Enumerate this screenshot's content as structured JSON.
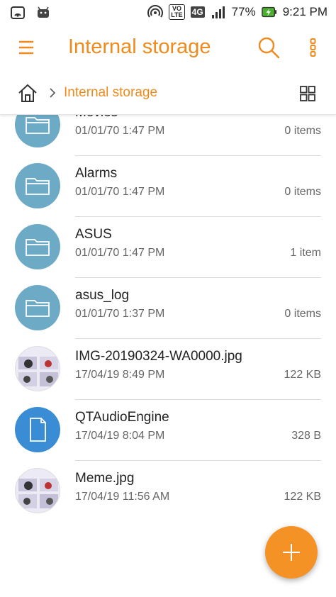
{
  "status_bar": {
    "battery_percent": "77%",
    "time": "9:21 PM",
    "volte_label": "VO\nLTE",
    "network_label": "4G",
    "icons": [
      "hotspot-icon",
      "android-icon",
      "wifi-calling-icon",
      "volte-icon",
      "network-4g-icon",
      "signal-icon",
      "battery-charging-icon"
    ]
  },
  "app_bar": {
    "title": "Internal storage",
    "icons": [
      "menu-icon",
      "search-icon",
      "more-vertical-icon"
    ]
  },
  "breadcrumb": {
    "current": "Internal storage",
    "icons": [
      "home-icon",
      "chevron-right-icon",
      "grid-view-icon"
    ]
  },
  "files": [
    {
      "name": "Movies",
      "date": "01/01/70 1:47 PM",
      "size": "0 items",
      "kind": "folder"
    },
    {
      "name": "Alarms",
      "date": "01/01/70 1:47 PM",
      "size": "0 items",
      "kind": "folder"
    },
    {
      "name": "ASUS",
      "date": "01/01/70 1:47 PM",
      "size": "1 item",
      "kind": "folder"
    },
    {
      "name": "asus_log",
      "date": "01/01/70 1:37 PM",
      "size": "0 items",
      "kind": "folder"
    },
    {
      "name": "IMG-20190324-WA0000.jpg",
      "date": "17/04/19 8:49 PM",
      "size": "122 KB",
      "kind": "image"
    },
    {
      "name": "QTAudioEngine",
      "date": "17/04/19 8:04 PM",
      "size": "328 B",
      "kind": "file"
    },
    {
      "name": "Meme.jpg",
      "date": "17/04/19 11:56 AM",
      "size": "122 KB",
      "kind": "image"
    }
  ],
  "fab": {
    "icon": "plus-icon"
  },
  "colors": {
    "accent": "#ef8a1c",
    "fab": "#f59226",
    "folder": "#6daac6",
    "file": "#3a8cd4"
  }
}
